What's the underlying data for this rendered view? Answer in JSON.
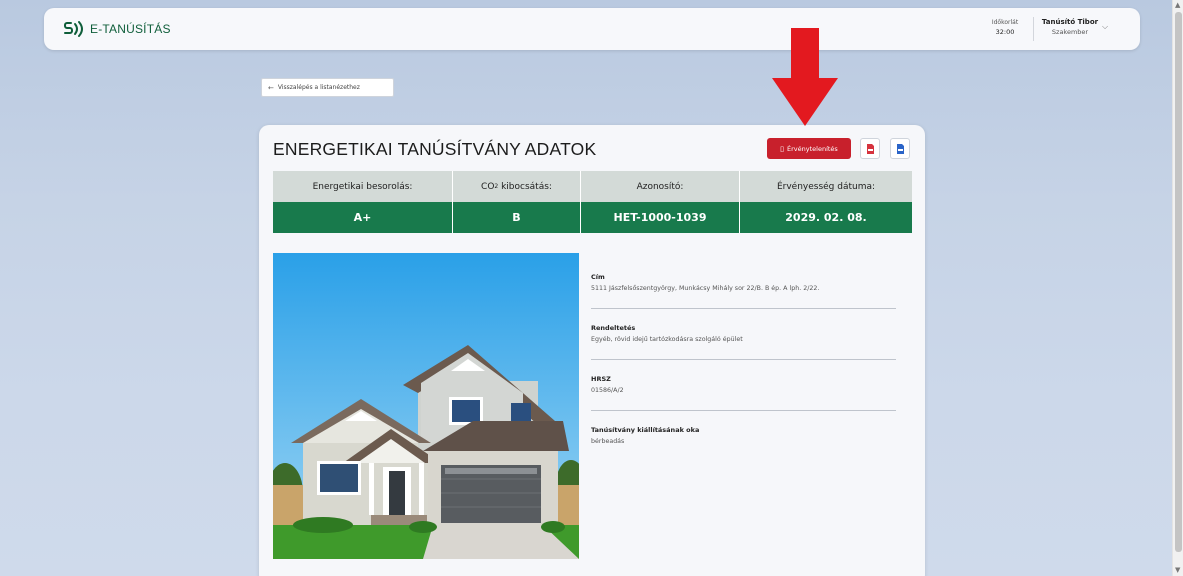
{
  "header": {
    "logo_text": "E-TANÚSÍTÁS",
    "timer_label": "Időkorlát",
    "timer_value": "32:00",
    "user_name": "Tanúsító Tibor",
    "user_role": "Szakember"
  },
  "back_button": {
    "label": "Visszalépés a listanézethez"
  },
  "card": {
    "title": "ENERGETIKAI TANÚSÍTVÁNY ADATOK",
    "invalidate_label": "Érvénytelenítés"
  },
  "summary": {
    "headers": {
      "rating": "Energetikai besorolás:",
      "co2_prefix": "CO",
      "co2_sub": "2",
      "co2_suffix": " kibocsátás:",
      "id": "Azonosító:",
      "validity": "Érvényesség dátuma:"
    },
    "values": {
      "rating": "A+",
      "co2": "B",
      "id": "HET-1000-1039",
      "validity": "2029. 02. 08."
    }
  },
  "details": [
    {
      "label": "Cím",
      "value": "5111 Jászfelsőszentgyörgy, Munkácsy Mihály sor 22/B. B ép. A lph. 2/22."
    },
    {
      "label": "Rendeltetés",
      "value": "Egyéb, rövid idejű tartózkodásra szolgáló épület"
    },
    {
      "label": "HRSZ",
      "value": "01586/A/2"
    },
    {
      "label": "Tanúsítvány kiállításának oka",
      "value": "bérbeadás"
    }
  ],
  "colors": {
    "brand_green": "#187a4c",
    "danger_red": "#c8202c",
    "arrow_red": "#e3191f"
  }
}
